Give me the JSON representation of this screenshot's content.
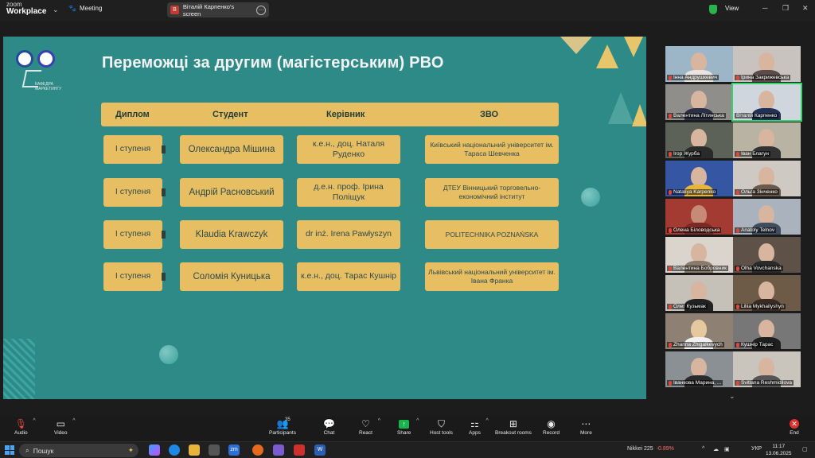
{
  "app": {
    "brand_top": "zoom",
    "brand_bottom": "Workplace",
    "meeting_label": "Meeting",
    "view_label": "View"
  },
  "screen_share": {
    "avatar_letter": "В",
    "label": "Віталій Карпенко's screen",
    "more": "···"
  },
  "slide": {
    "title": "Переможці за другим (магістерським) РВО",
    "logo_text_1": "КАФЕДРА",
    "logo_text_2": "МАРКЕТИНГУ",
    "headers": [
      "Диплом",
      "Студент",
      "Керівник",
      "ЗВО"
    ],
    "rows": [
      {
        "diploma": "І ступеня",
        "student": "Олександра Мішина",
        "supervisor": "к.е.н., доц. Наталя Руденко",
        "university": "Київський національний університет ім. Тараса Шевченка"
      },
      {
        "diploma": "І ступеня",
        "student": "Андрій Расновський",
        "supervisor": "д.е.н. проф. Ірина Поліщук",
        "university": "ДТЕУ Вінницький торговельно-економічний інститут"
      },
      {
        "diploma": "І ступеня",
        "student": "Klaudia Krawczyk",
        "supervisor": "dr inż. Irena Pawłyszyn",
        "university": "POLITECHNIKA POZNAŃSKA"
      },
      {
        "diploma": "І ступеня",
        "student": "Соломія Куницька",
        "supervisor": "к.е.н., доц. Тарас Кушнір",
        "university": "Львівський національний університет ім. Івана Франка"
      }
    ]
  },
  "gallery": {
    "participants": [
      {
        "name": "Інна Андрушкевич"
      },
      {
        "name": "Ірина Закрижевська"
      },
      {
        "name": "Валентина Літинська"
      },
      {
        "name": "Віталій Карпенко"
      },
      {
        "name": "Ігор Журба"
      },
      {
        "name": "Іван Благун"
      },
      {
        "name": "Nataliya Karpenko"
      },
      {
        "name": "Ольга Зінченко"
      },
      {
        "name": "Олена Біловодська"
      },
      {
        "name": "Anatoly Telnov"
      },
      {
        "name": "Валентина Бобровник"
      },
      {
        "name": "Olha Vovchanska"
      },
      {
        "name": "Олег Кузьмак"
      },
      {
        "name": "Liliia Mykhailyshyn"
      },
      {
        "name": "Zhanna Zhigalkevych"
      },
      {
        "name": "Кушнір Тарас"
      },
      {
        "name": "Іванкова Марина, ..."
      },
      {
        "name": "Svitlana Reshmidilova"
      }
    ]
  },
  "toolbar": {
    "audio": "Audio",
    "video": "Video",
    "participants": "Participants",
    "participants_count": "35",
    "chat": "Chat",
    "react": "React",
    "share": "Share",
    "host_tools": "Host tools",
    "apps": "Apps",
    "breakout": "Breakout rooms",
    "record": "Record",
    "more": "More",
    "end": "End"
  },
  "taskbar": {
    "search": "Пошук",
    "stock_name": "Nikkei 225",
    "stock_change": "-0.89%",
    "lang": "УКР",
    "time": "11:17",
    "date": "13.06.2025",
    "zoom_app": "zm",
    "word_app": "W"
  },
  "colors": {
    "slide_bg": "#2d8a87",
    "cell": "#e8be63",
    "share_green": "#19b34d",
    "end_red": "#e0302d"
  }
}
